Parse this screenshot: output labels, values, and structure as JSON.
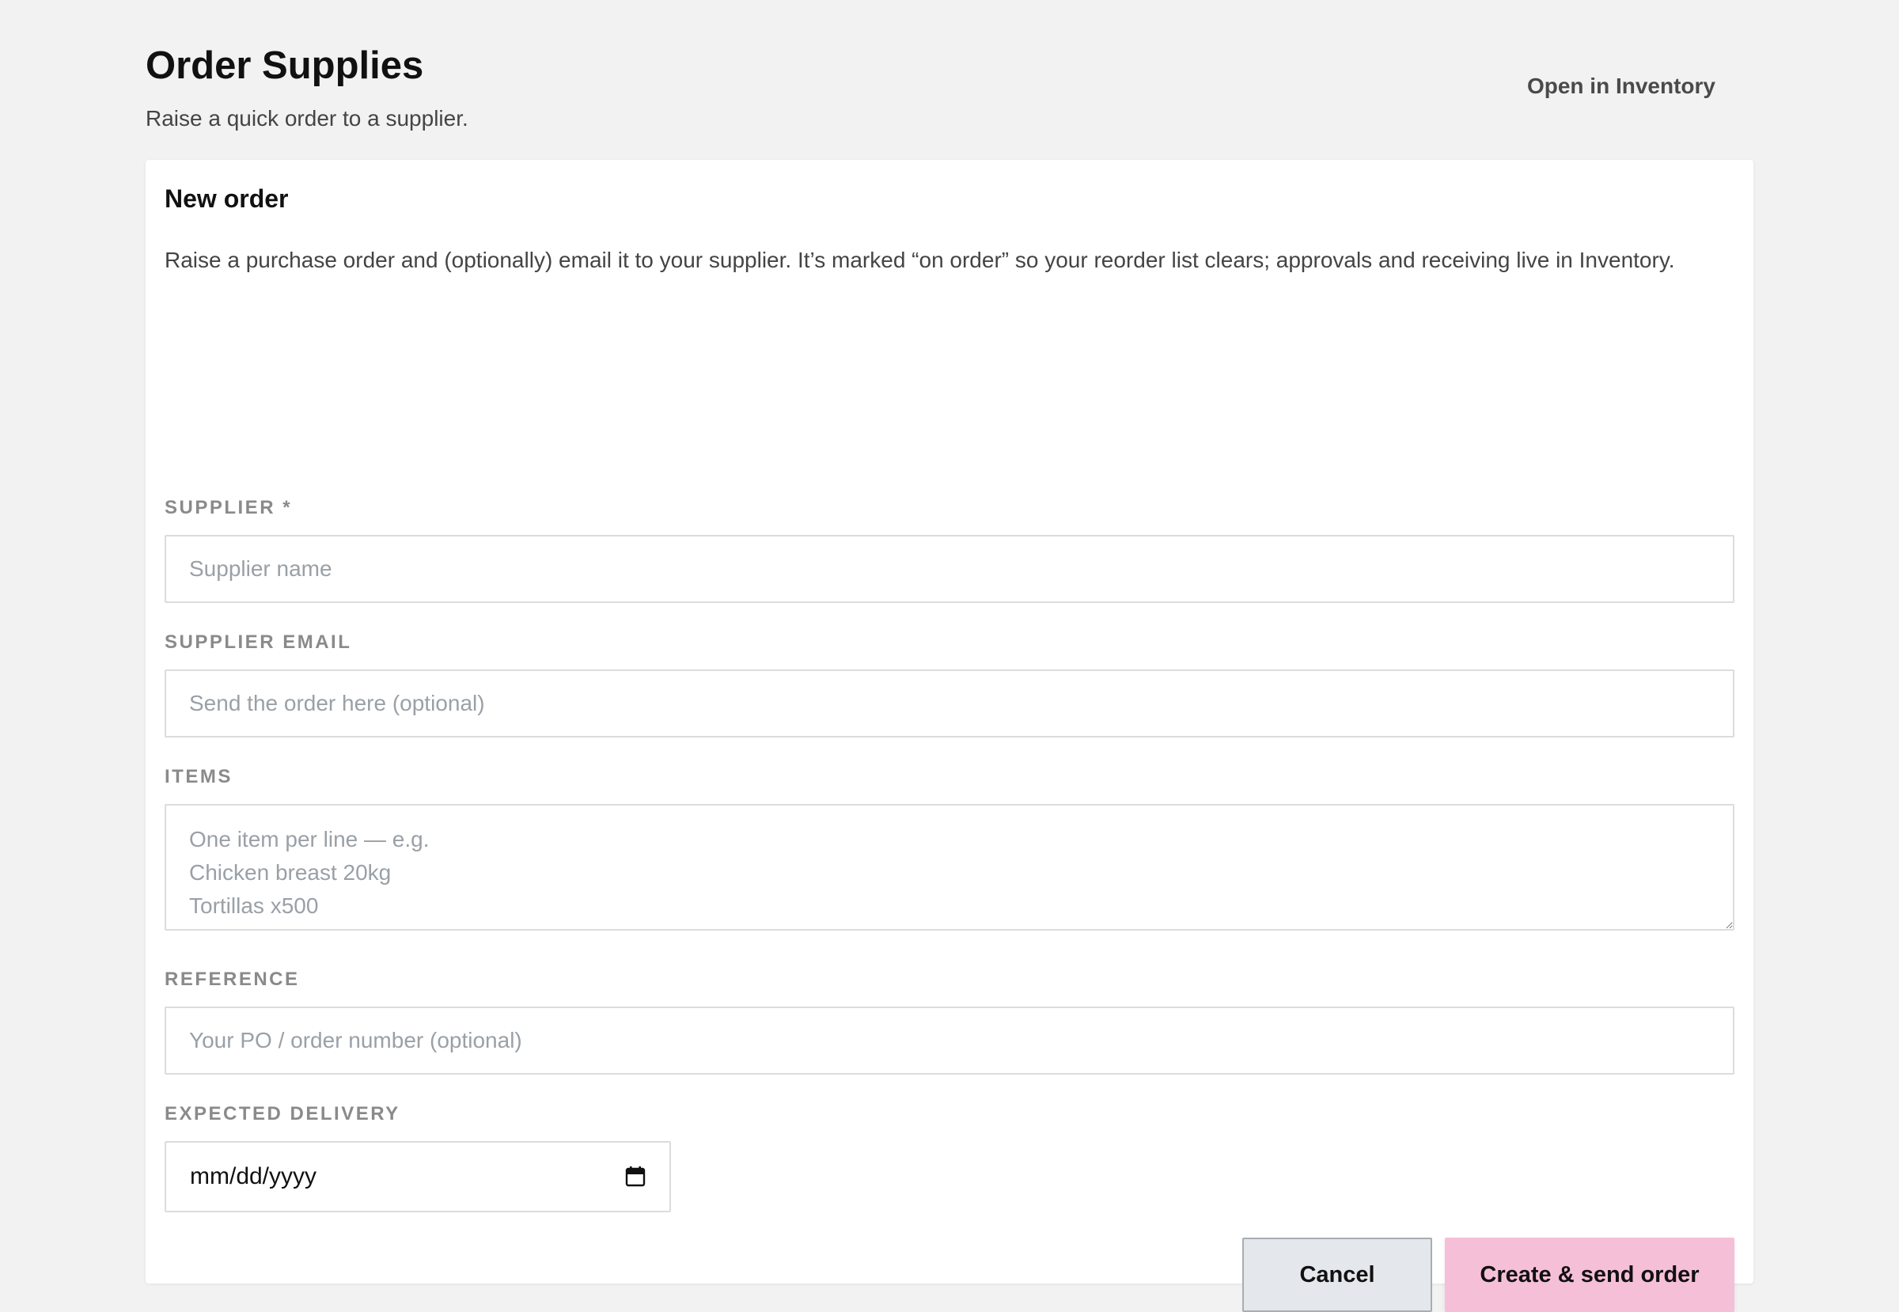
{
  "header": {
    "title": "Order Supplies",
    "subtitle": "Raise a quick order to a supplier.",
    "open_link": "Open in Inventory"
  },
  "form": {
    "title": "New order",
    "description": "Raise a purchase order and (optionally) email it to your supplier. It’s marked “on order” so your reorder list clears; approvals and receiving live in Inventory.",
    "supplier": {
      "label": "SUPPLIER *",
      "value": "",
      "placeholder": "Supplier name"
    },
    "supplier_email": {
      "label": "SUPPLIER EMAIL",
      "value": "",
      "placeholder": "Send the order here (optional)"
    },
    "items": {
      "label": "ITEMS",
      "value": "",
      "placeholder": "One item per line — e.g.\nChicken breast 20kg\nTortillas x500"
    },
    "reference": {
      "label": "REFERENCE",
      "value": "",
      "placeholder": "Your PO / order number (optional)"
    },
    "expected_delivery": {
      "label": "EXPECTED DELIVERY",
      "value": "mm/dd/yyyy",
      "icon": "calendar-icon"
    },
    "cancel_label": "Cancel",
    "submit_label": "Create & send order"
  },
  "colors": {
    "page_background": "#f2f2f2",
    "card_background": "#ffffff",
    "primary_button": "#f6bfd8",
    "cancel_button": "#e4e7eb",
    "label_text": "#8a8a8a",
    "placeholder_text": "#9aa0a6"
  }
}
